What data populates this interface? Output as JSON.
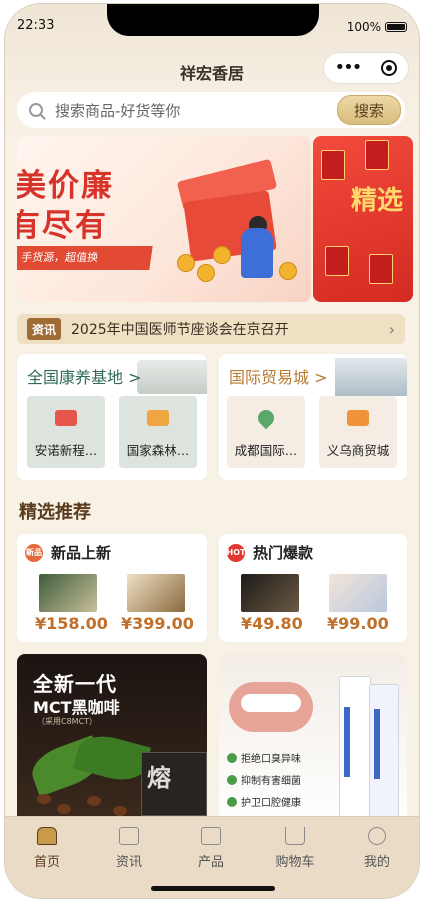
{
  "status": {
    "time": "22:33",
    "battery": "100%"
  },
  "header": {
    "title": "祥宏香居"
  },
  "search": {
    "placeholder": "搜索商品-好货等你",
    "button": "搜索"
  },
  "banner": {
    "line1": "美价廉",
    "line2": "有尽有",
    "ribbon": "手货源，超值换",
    "side_text": "精选"
  },
  "news": {
    "tag": "资讯",
    "text": "2025年中国医师节座谈会在京召开"
  },
  "bases": [
    {
      "title": "全国康养基地 >",
      "items": [
        {
          "label": "安诺新程…"
        },
        {
          "label": "国家森林…"
        }
      ]
    },
    {
      "title": "国际贸易城 >",
      "items": [
        {
          "label": "成都国际…"
        },
        {
          "label": "义乌商贸城"
        }
      ]
    }
  ],
  "section": {
    "title": "精选推荐"
  },
  "recommend": [
    {
      "badge": "新品",
      "title": "新品上新",
      "prices": [
        "¥158.00",
        "¥399.00"
      ]
    },
    {
      "badge": "HOT",
      "title": "热门爆款",
      "prices": [
        "¥49.80",
        "¥99.00"
      ]
    }
  ],
  "promo_coffee": {
    "line1": "全新一代",
    "line2": "MCT黑咖啡",
    "line3": "（采用C8MCT）",
    "box": "熔"
  },
  "promo_toothpaste": {
    "bullets": [
      "拒绝口臭异味",
      "抑制有害细菌",
      "护卫口腔健康"
    ]
  },
  "tabs": [
    {
      "label": "首页",
      "icon": "home-icon",
      "active": true
    },
    {
      "label": "资讯",
      "icon": "book-icon",
      "active": false
    },
    {
      "label": "产品",
      "icon": "bag-icon",
      "active": false
    },
    {
      "label": "购物车",
      "icon": "cart-icon",
      "active": false
    },
    {
      "label": "我的",
      "icon": "user-icon",
      "active": false
    }
  ],
  "colors": {
    "accent": "#c0702b",
    "brand_brown": "#5a3b1d",
    "green": "#2f6b55",
    "red": "#d6342a"
  }
}
